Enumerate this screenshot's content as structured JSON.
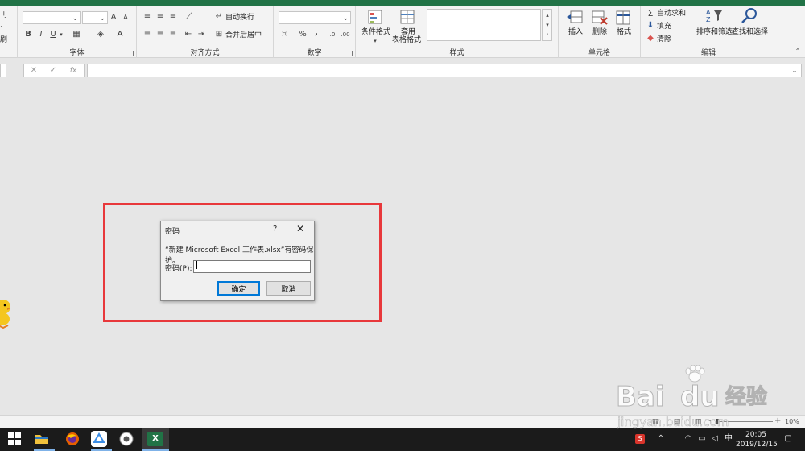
{
  "ribbon": {
    "clipboard_partial_1": "刷",
    "font_group_label": "字体",
    "font_bold": "B",
    "font_italic": "I",
    "font_underline": "U",
    "font_grow": "A",
    "font_shrink": "A",
    "align_group_label": "对齐方式",
    "wrap_text": "自动换行",
    "merge_center": "合并后居中",
    "number_group_label": "数字",
    "percent": "%",
    "comma": ",",
    "cond_format": "条件格式",
    "table_format_1": "套用",
    "table_format_2": "表格格式",
    "styles_group_label": "样式",
    "insert": "插入",
    "delete": "删除",
    "format": "格式",
    "cells_group_label": "单元格",
    "autosum": "自动求和",
    "fill": "填充",
    "clear": "清除",
    "sort_filter": "排序和筛选",
    "find_select": "查找和选择",
    "editing_group_label": "编辑"
  },
  "formula_bar": {
    "cancel": "✕",
    "enter": "✓",
    "fx": "fx"
  },
  "dialog": {
    "title": "密码",
    "help": "?",
    "close": "✕",
    "message": "“新建 Microsoft Excel 工作表.xlsx”有密码保护。",
    "password_label": "密码(P):",
    "password_value": "",
    "ok_label": "确定",
    "cancel_label": "取消"
  },
  "statusbar": {
    "zoom": "10%",
    "zoom_minus": "-",
    "zoom_plus": "+"
  },
  "taskbar": {
    "time": "20:05",
    "date": "2019/12/15",
    "ime": "中",
    "excel_label": "X"
  },
  "watermark": {
    "brand": "Bai",
    "brand2": "du",
    "brand_cn": "经验",
    "url": "jingyan.baidu.com"
  },
  "colors": {
    "excel_green": "#217346",
    "highlight_red": "#e8383b",
    "focus_blue": "#0078d7"
  }
}
